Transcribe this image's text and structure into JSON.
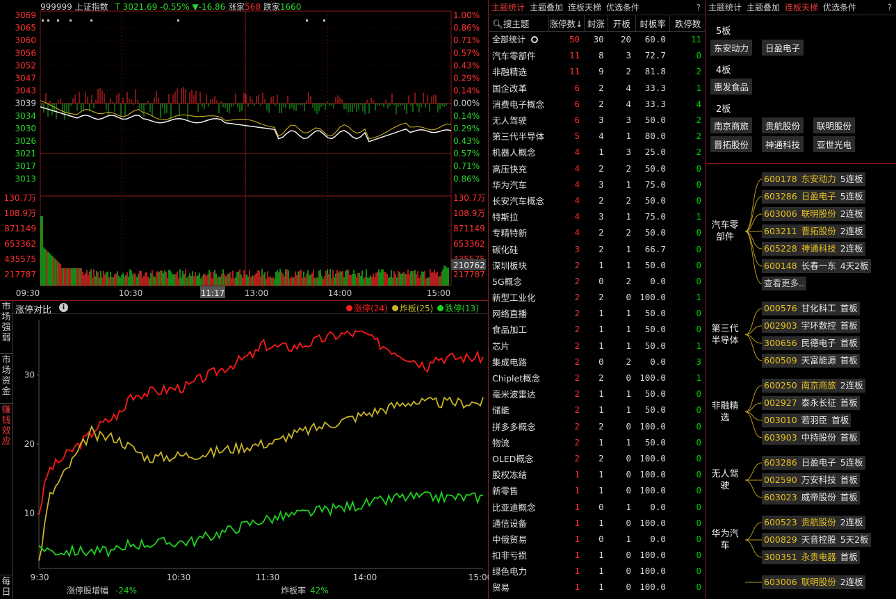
{
  "index": {
    "code": "999999",
    "name": "上证指数",
    "t_label": "T",
    "price": "3021.69",
    "pct": "-0.55%",
    "chg_arrow": "▼",
    "chg": "-16.86",
    "up_label": "涨家",
    "up": "568",
    "down_label": "跌家",
    "down": "1660"
  },
  "price_axis": {
    "left": [
      "3069",
      "3065",
      "3060",
      "3056",
      "3052",
      "3047",
      "3043",
      "3039",
      "3034",
      "3030",
      "3026",
      "3021",
      "3017",
      "3013"
    ],
    "right": [
      "1.00%",
      "0.86%",
      "0.71%",
      "0.57%",
      "0.43%",
      "0.29%",
      "0.14%",
      "0.00%",
      "0.14%",
      "0.29%",
      "0.43%",
      "0.57%",
      "0.71%",
      "0.86%"
    ]
  },
  "volume_axis": {
    "left": [
      "130.7万",
      "108.9万",
      "871149",
      "653362",
      "435575",
      "217787"
    ],
    "right": [
      "130.7万",
      "108.9万",
      "871149",
      "653362",
      "435575",
      "217787"
    ],
    "cursor_value": "210762"
  },
  "time_axis": [
    "09:30",
    "10:30",
    "11:17",
    "13:00",
    "14:00",
    "15:00"
  ],
  "compare": {
    "title": "涨停对比",
    "info_icon": "info-circle-icon",
    "legend": [
      {
        "label": "涨停(24)",
        "color": "#ff1a1a"
      },
      {
        "label": "炸板(25)",
        "color": "#c8b428"
      },
      {
        "label": "跌停(13)",
        "color": "#1fd11f"
      }
    ],
    "y_ticks": [
      "30",
      "20",
      "10"
    ],
    "x_ticks": [
      "9:30",
      "10:30",
      "11:30",
      "14:00",
      "15:00"
    ],
    "bottom_left_label": "涨停股增幅",
    "bottom_left_value": "-24%",
    "bottom_right_label": "炸板率",
    "bottom_right_value": "42%"
  },
  "side_tabs": [
    "市场强弱",
    "市场资金",
    "赚钱效应",
    "每日"
  ],
  "mid_tabs": [
    "主题统计",
    "主题叠加",
    "连板天梯",
    "优选条件"
  ],
  "right_tabs": [
    "主题统计",
    "主题叠加",
    "连板天梯",
    "优选条件"
  ],
  "help": "?",
  "table": {
    "search": "搜主题",
    "headers": [
      "涨停数↓",
      "封涨",
      "开板",
      "封板率",
      "跌停数"
    ],
    "rows": [
      [
        "全部统计",
        "50",
        "30",
        "20",
        "60.0",
        "11"
      ],
      [
        "汽车零部件",
        "11",
        "8",
        "3",
        "72.7",
        "0"
      ],
      [
        "非融精选",
        "11",
        "9",
        "2",
        "81.8",
        "2"
      ],
      [
        "国企改革",
        "6",
        "2",
        "4",
        "33.3",
        "1"
      ],
      [
        "消费电子概念",
        "6",
        "2",
        "4",
        "33.3",
        "4"
      ],
      [
        "无人驾驶",
        "6",
        "3",
        "3",
        "50.0",
        "2"
      ],
      [
        "第三代半导体",
        "5",
        "4",
        "1",
        "80.0",
        "2"
      ],
      [
        "机器人概念",
        "4",
        "1",
        "3",
        "25.0",
        "2"
      ],
      [
        "高压快充",
        "4",
        "2",
        "2",
        "50.0",
        "0"
      ],
      [
        "华为汽车",
        "4",
        "3",
        "1",
        "75.0",
        "0"
      ],
      [
        "长安汽车概念",
        "4",
        "2",
        "2",
        "50.0",
        "0"
      ],
      [
        "特斯拉",
        "4",
        "3",
        "1",
        "75.0",
        "1"
      ],
      [
        "专精特新",
        "4",
        "2",
        "2",
        "50.0",
        "0"
      ],
      [
        "碳化硅",
        "3",
        "2",
        "1",
        "66.7",
        "0"
      ],
      [
        "深圳板块",
        "2",
        "1",
        "1",
        "50.0",
        "0"
      ],
      [
        "5G概念",
        "2",
        "0",
        "2",
        "0.0",
        "0"
      ],
      [
        "新型工业化",
        "2",
        "2",
        "0",
        "100.0",
        "1"
      ],
      [
        "网络直播",
        "2",
        "1",
        "1",
        "50.0",
        "0"
      ],
      [
        "食品加工",
        "2",
        "1",
        "1",
        "50.0",
        "0"
      ],
      [
        "芯片",
        "2",
        "1",
        "1",
        "50.0",
        "1"
      ],
      [
        "集成电路",
        "2",
        "0",
        "2",
        "0.0",
        "3"
      ],
      [
        "Chiplet概念",
        "2",
        "2",
        "0",
        "100.0",
        "1"
      ],
      [
        "毫米波雷达",
        "2",
        "1",
        "1",
        "50.0",
        "0"
      ],
      [
        "储能",
        "2",
        "1",
        "1",
        "50.0",
        "0"
      ],
      [
        "拼多多概念",
        "2",
        "2",
        "0",
        "100.0",
        "0"
      ],
      [
        "物流",
        "2",
        "1",
        "1",
        "50.0",
        "0"
      ],
      [
        "OLED概念",
        "2",
        "2",
        "0",
        "100.0",
        "0"
      ],
      [
        "股权冻结",
        "1",
        "1",
        "0",
        "100.0",
        "0"
      ],
      [
        "新零售",
        "1",
        "1",
        "0",
        "100.0",
        "0"
      ],
      [
        "比亚迪概念",
        "1",
        "0",
        "1",
        "0.0",
        "0"
      ],
      [
        "通信设备",
        "1",
        "1",
        "0",
        "100.0",
        "0"
      ],
      [
        "中俄贸易",
        "1",
        "0",
        "1",
        "0.0",
        "0"
      ],
      [
        "扣非亏损",
        "1",
        "1",
        "0",
        "100.0",
        "0"
      ],
      [
        "绿色电力",
        "1",
        "1",
        "0",
        "100.0",
        "0"
      ],
      [
        "贸易",
        "1",
        "1",
        "0",
        "100.0",
        "0"
      ]
    ]
  },
  "ladder": [
    {
      "level": "5板",
      "stocks": [
        "东安动力",
        "日盈电子"
      ]
    },
    {
      "level": "4板",
      "stocks": [
        "惠发食品"
      ]
    },
    {
      "level": "2板",
      "stocks": [
        "南京商旅",
        "贵航股份",
        "联明股份",
        "晋拓股份",
        "神通科技",
        "亚世光电"
      ]
    }
  ],
  "tree": [
    {
      "group": "汽车零部件",
      "items": [
        [
          "600178",
          "东安动力",
          "5连板"
        ],
        [
          "603286",
          "日盈电子",
          "5连板"
        ],
        [
          "603006",
          "联明股份",
          "2连板"
        ],
        [
          "603211",
          "晋拓股份",
          "2连板"
        ],
        [
          "605228",
          "神通科技",
          "2连板"
        ],
        [
          "600148",
          "长春一东",
          "4天2板"
        ]
      ],
      "more": "查看更多.."
    },
    {
      "group": "第三代半导体",
      "items": [
        [
          "000576",
          "甘化科工",
          "首板"
        ],
        [
          "002903",
          "宇环数控",
          "首板"
        ],
        [
          "300656",
          "民德电子",
          "首板"
        ],
        [
          "600509",
          "天富能源",
          "首板"
        ]
      ]
    },
    {
      "group": "非融精选",
      "items": [
        [
          "600250",
          "南京商旅",
          "2连板"
        ],
        [
          "002927",
          "泰永长征",
          "首板"
        ],
        [
          "003010",
          "若羽臣",
          "首板"
        ],
        [
          "603903",
          "中持股份",
          "首板"
        ]
      ]
    },
    {
      "group": "无人驾驶",
      "items": [
        [
          "603286",
          "日盈电子",
          "5连板"
        ],
        [
          "002590",
          "万安科技",
          "首板"
        ],
        [
          "603023",
          "威帝股份",
          "首板"
        ]
      ]
    },
    {
      "group": "华为汽车",
      "items": [
        [
          "600523",
          "贵航股份",
          "2连板"
        ],
        [
          "000829",
          "天音控股",
          "5天2板"
        ],
        [
          "300351",
          "永贵电器",
          "首板"
        ]
      ]
    },
    {
      "group": "",
      "items": [
        [
          "603006",
          "联明股份",
          "2连板"
        ]
      ]
    }
  ]
}
